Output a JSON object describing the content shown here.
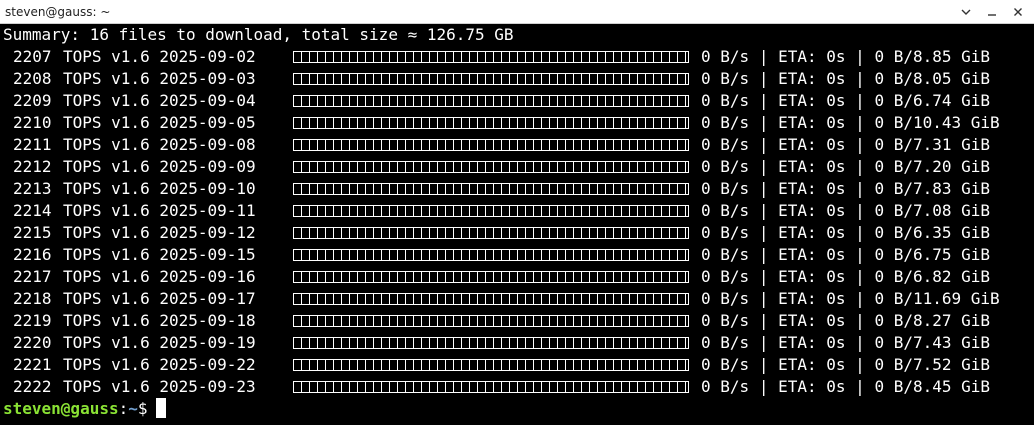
{
  "window": {
    "title": "steven@gauss: ~",
    "icons": [
      "chevron-down-icon",
      "minimize-icon",
      "close-icon"
    ]
  },
  "terminal": {
    "summary": "Summary: 16 files to download, total size ≈ 126.75 GB",
    "rows": [
      {
        "id": "2207",
        "name": "TOPS v1.6 2025-09-02",
        "speed": "0 B/s",
        "eta": "ETA: 0s",
        "size": "0 B/8.85 GiB",
        "progress": 0
      },
      {
        "id": "2208",
        "name": "TOPS v1.6 2025-09-03",
        "speed": "0 B/s",
        "eta": "ETA: 0s",
        "size": "0 B/8.05 GiB",
        "progress": 0
      },
      {
        "id": "2209",
        "name": "TOPS v1.6 2025-09-04",
        "speed": "0 B/s",
        "eta": "ETA: 0s",
        "size": "0 B/6.74 GiB",
        "progress": 0
      },
      {
        "id": "2210",
        "name": "TOPS v1.6 2025-09-05",
        "speed": "0 B/s",
        "eta": "ETA: 0s",
        "size": "0 B/10.43 GiB",
        "progress": 0
      },
      {
        "id": "2211",
        "name": "TOPS v1.6 2025-09-08",
        "speed": "0 B/s",
        "eta": "ETA: 0s",
        "size": "0 B/7.31 GiB",
        "progress": 0
      },
      {
        "id": "2212",
        "name": "TOPS v1.6 2025-09-09",
        "speed": "0 B/s",
        "eta": "ETA: 0s",
        "size": "0 B/7.20 GiB",
        "progress": 0
      },
      {
        "id": "2213",
        "name": "TOPS v1.6 2025-09-10",
        "speed": "0 B/s",
        "eta": "ETA: 0s",
        "size": "0 B/7.83 GiB",
        "progress": 0
      },
      {
        "id": "2214",
        "name": "TOPS v1.6 2025-09-11",
        "speed": "0 B/s",
        "eta": "ETA: 0s",
        "size": "0 B/7.08 GiB",
        "progress": 0
      },
      {
        "id": "2215",
        "name": "TOPS v1.6 2025-09-12",
        "speed": "0 B/s",
        "eta": "ETA: 0s",
        "size": "0 B/6.35 GiB",
        "progress": 0
      },
      {
        "id": "2216",
        "name": "TOPS v1.6 2025-09-15",
        "speed": "0 B/s",
        "eta": "ETA: 0s",
        "size": "0 B/6.75 GiB",
        "progress": 0
      },
      {
        "id": "2217",
        "name": "TOPS v1.6 2025-09-16",
        "speed": "0 B/s",
        "eta": "ETA: 0s",
        "size": "0 B/6.82 GiB",
        "progress": 0
      },
      {
        "id": "2218",
        "name": "TOPS v1.6 2025-09-17",
        "speed": "0 B/s",
        "eta": "ETA: 0s",
        "size": "0 B/11.69 GiB",
        "progress": 0
      },
      {
        "id": "2219",
        "name": "TOPS v1.6 2025-09-18",
        "speed": "0 B/s",
        "eta": "ETA: 0s",
        "size": "0 B/8.27 GiB",
        "progress": 0
      },
      {
        "id": "2220",
        "name": "TOPS v1.6 2025-09-19",
        "speed": "0 B/s",
        "eta": "ETA: 0s",
        "size": "0 B/7.43 GiB",
        "progress": 0
      },
      {
        "id": "2221",
        "name": "TOPS v1.6 2025-09-22",
        "speed": "0 B/s",
        "eta": "ETA: 0s",
        "size": "0 B/7.52 GiB",
        "progress": 0
      },
      {
        "id": "2222",
        "name": "TOPS v1.6 2025-09-23",
        "speed": "0 B/s",
        "eta": "ETA: 0s",
        "size": "0 B/8.45 GiB",
        "progress": 0
      }
    ],
    "separator": "|",
    "prompt": {
      "user_host": "steven@gauss",
      "colon": ":",
      "path": "~",
      "symbol": "$"
    }
  },
  "colors": {
    "prompt_user": "#8ae234",
    "prompt_path": "#729fcf",
    "text": "#ffffff",
    "background": "#000000"
  }
}
